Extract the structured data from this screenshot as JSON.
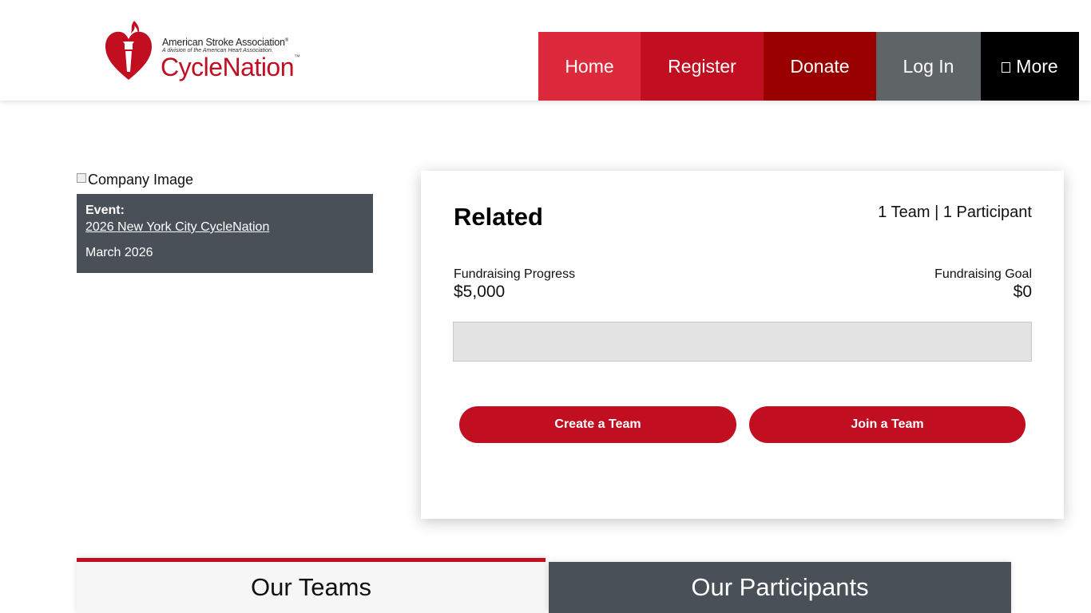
{
  "header": {
    "logo": {
      "org": "American Stroke Association",
      "division": "A division of the American Heart Association.",
      "brand": "CycleNation",
      "brand_tm": "™",
      "org_mark": "®"
    },
    "nav": [
      {
        "label": "Home",
        "color": "#dc2a3c"
      },
      {
        "label": "Register",
        "color": "#c10e21"
      },
      {
        "label": "Donate",
        "color": "#990000"
      },
      {
        "label": "Log In",
        "color": "#5f6466"
      },
      {
        "label": "More",
        "icon": "grid-icon",
        "color": "#000000"
      }
    ]
  },
  "sidebar": {
    "image_alt": "Company Image",
    "event_label": "Event:",
    "event_name": "2026 New York City CycleNation",
    "event_date": "March 2026"
  },
  "card": {
    "title": "Related",
    "counts": "1 Team | 1 Participant",
    "progress_label": "Fundraising Progress",
    "progress_value": "$5,000",
    "goal_label": "Fundraising Goal",
    "goal_value": "$0",
    "progress_fraction": 0,
    "buttons": {
      "create": "Create a Team",
      "join": "Join a Team"
    }
  },
  "tabs": [
    {
      "label": "Our Teams",
      "active": true
    },
    {
      "label": "Our Participants",
      "active": false
    }
  ],
  "colors": {
    "accent": "#c10e21",
    "dark_panel": "#4a5058"
  }
}
